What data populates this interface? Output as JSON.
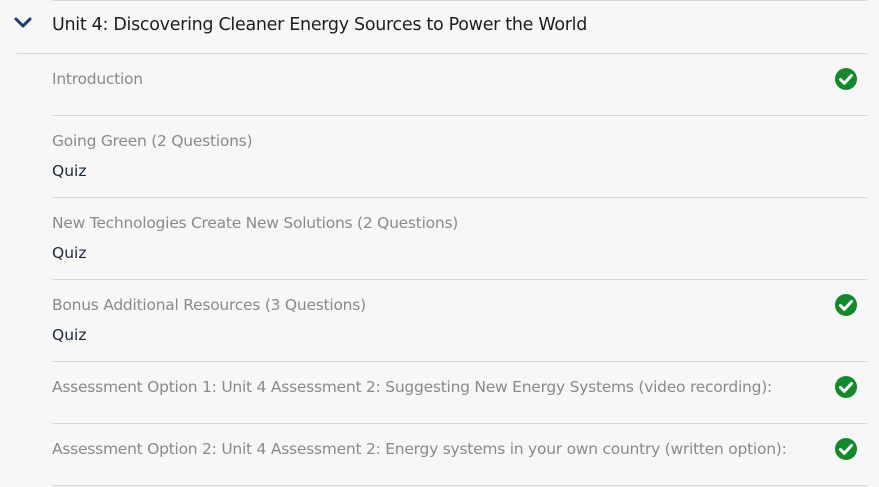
{
  "unit": {
    "title": "Unit 4: Discovering Cleaner Energy Sources to Power the World",
    "expand_icon": "chevron-down-icon"
  },
  "items": [
    {
      "title": "Introduction",
      "type": "",
      "completed": true
    },
    {
      "title": "Going Green (2 Questions)",
      "type": "Quiz",
      "completed": false
    },
    {
      "title": "New Technologies Create New Solutions (2 Questions)",
      "type": "Quiz",
      "completed": false
    },
    {
      "title": "Bonus Additional Resources (3 Questions)",
      "type": "Quiz",
      "completed": true
    },
    {
      "title": "Assessment Option 1: Unit 4 Assessment 2: Suggesting New Energy Systems (video recording):",
      "type": "",
      "completed": true
    },
    {
      "title": "Assessment Option 2: Unit 4 Assessment 2: Energy systems in your own country (written option):",
      "type": "",
      "completed": true
    }
  ],
  "colors": {
    "check": "#118a2b",
    "chevron": "#1f3b6d",
    "muted_text": "#8a8a8a",
    "dark_text": "#1e2a3a"
  }
}
